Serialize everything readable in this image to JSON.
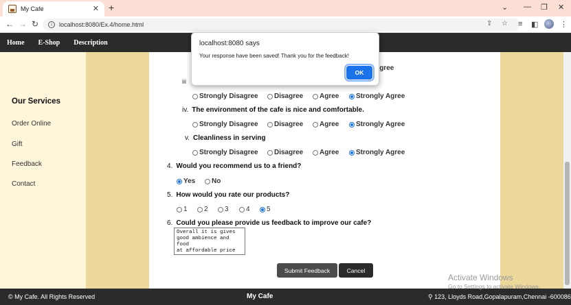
{
  "browser": {
    "tab_title": "My Cafe",
    "url": "localhost:8080/Ex.4/home.html"
  },
  "site_nav": [
    "Home",
    "E-Shop",
    "Description"
  ],
  "sidebar": {
    "title": "Our Services",
    "items": [
      "Order Online",
      "Gift",
      "Feedback",
      "Contact"
    ]
  },
  "form": {
    "sub_iii": {
      "numeral": "iii",
      "partial_label": "y Agree"
    },
    "sub_iv": {
      "numeral": "iv.",
      "question": "The environment of the cafe is nice and comfortable."
    },
    "sub_v": {
      "numeral": "v.",
      "question": "Cleanliness in serving"
    },
    "agree_options": [
      "Strongly Disagree",
      "Disagree",
      "Agree",
      "Strongly Agree"
    ],
    "q4": {
      "num": "4.",
      "question": "Would you recommend us to a friend?",
      "options": [
        "Yes",
        "No"
      ]
    },
    "q5": {
      "num": "5.",
      "question": "How would you rate our products?",
      "options": [
        "1",
        "2",
        "3",
        "4",
        "5"
      ]
    },
    "q6": {
      "num": "6.",
      "question": "Could you please provide us feedback to improve our cafe?",
      "answer": "Overall it is gives\ngood ambience and food\nat affordable price"
    },
    "submit_label": "Submit Feedback",
    "cancel_label": "Cancel"
  },
  "footer": {
    "left": "© My Cafe. All Rights Reserved",
    "center": "My Cafe",
    "right": "123, Lloyds Road,Gopalapuram,Chennai -600086"
  },
  "watermark": {
    "line1": "Activate Windows",
    "line2": "Go to Settings to activate Windows."
  },
  "alert": {
    "origin": "localhost:8080 says",
    "message": "Your response have been saved! Thank you for the feedback!",
    "ok_label": "OK"
  },
  "colors": {
    "nav_bg": "#2b2b2b",
    "sidebar_bg": "#fdf6da",
    "accent_col": "#ecd89a",
    "radio_selected": "#1a73e8",
    "tabstrip": "#fbdfd5"
  }
}
